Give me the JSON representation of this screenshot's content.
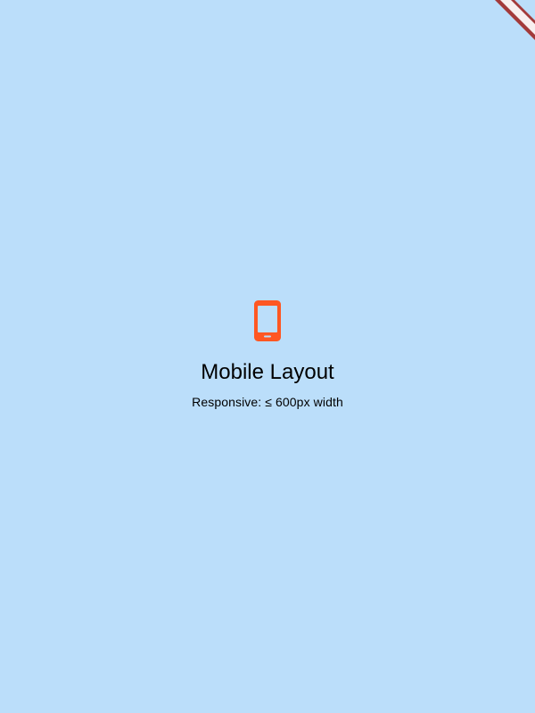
{
  "screen": {
    "background_color": "#BBDEFA"
  },
  "debug_banner": {
    "icon": "debug-ribbon",
    "color": "#A33A3A"
  },
  "content": {
    "icon": "smartphone-icon",
    "icon_color": "#FF5722",
    "title": "Mobile Layout",
    "subtitle": "Responsive: ≤ 600px width"
  }
}
